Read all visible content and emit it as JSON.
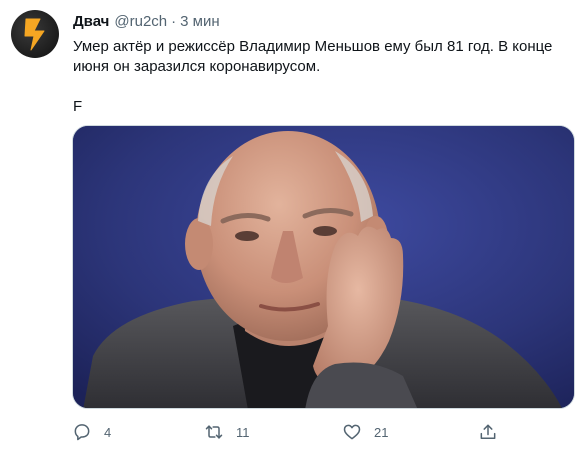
{
  "tweet": {
    "author_name": "Двач",
    "author_handle": "@ru2ch",
    "separator": "·",
    "time": "3 мин",
    "text_line1": "Умер актёр и режиссёр Владимир Меньшов ему был 81 год. В конце июня он заразился коронавирусом.",
    "text_line2": "F",
    "avatar_icon": "lightning-bolt-icon",
    "accent_color": "#f5a623"
  },
  "actions": {
    "reply_icon": "reply-icon",
    "reply_count": "4",
    "retweet_icon": "retweet-icon",
    "retweet_count": "11",
    "like_icon": "heart-icon",
    "like_count": "21",
    "share_icon": "share-icon"
  }
}
